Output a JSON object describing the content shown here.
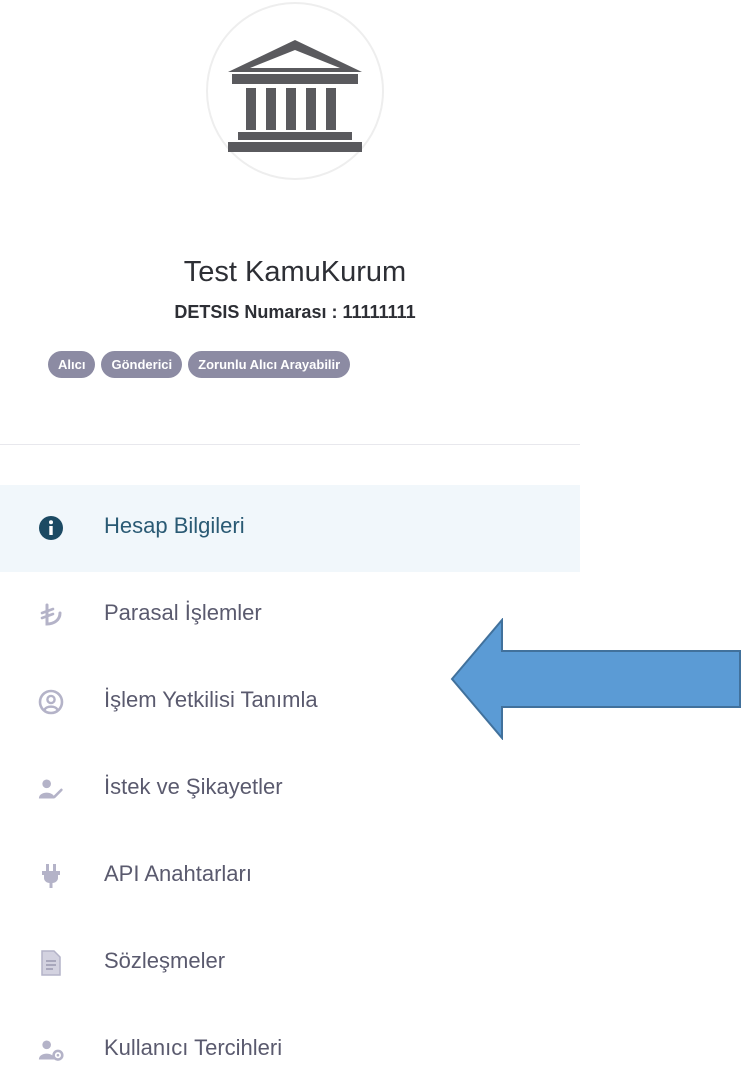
{
  "profile": {
    "name": "Test KamuKurum",
    "detsis": "DETSIS Numarası : 11111111",
    "avatar_icon": "government-building-icon",
    "badges": [
      "Alıcı",
      "Gönderici",
      "Zorunlu Alıcı Arayabilir"
    ]
  },
  "menu": {
    "items": [
      {
        "label": "Hesap Bilgileri",
        "icon": "info-circle-icon",
        "active": true
      },
      {
        "label": "Parasal İşlemler",
        "icon": "turkish-lira-icon",
        "active": false
      },
      {
        "label": "İşlem Yetkilisi Tanımla",
        "icon": "user-circle-icon",
        "active": false
      },
      {
        "label": "İstek ve Şikayetler",
        "icon": "user-edit-icon",
        "active": false
      },
      {
        "label": "API Anahtarları",
        "icon": "plug-icon",
        "active": false
      },
      {
        "label": "Sözleşmeler",
        "icon": "document-icon",
        "active": false
      },
      {
        "label": "Kullanıcı Tercihleri",
        "icon": "user-settings-icon",
        "active": false
      }
    ]
  },
  "colors": {
    "active_bg": "#f1f7fb",
    "active_text": "#2a5a74",
    "badge_bg": "#8c8ba3",
    "arrow_fill": "#5b9bd5",
    "arrow_stroke": "#41719c"
  }
}
